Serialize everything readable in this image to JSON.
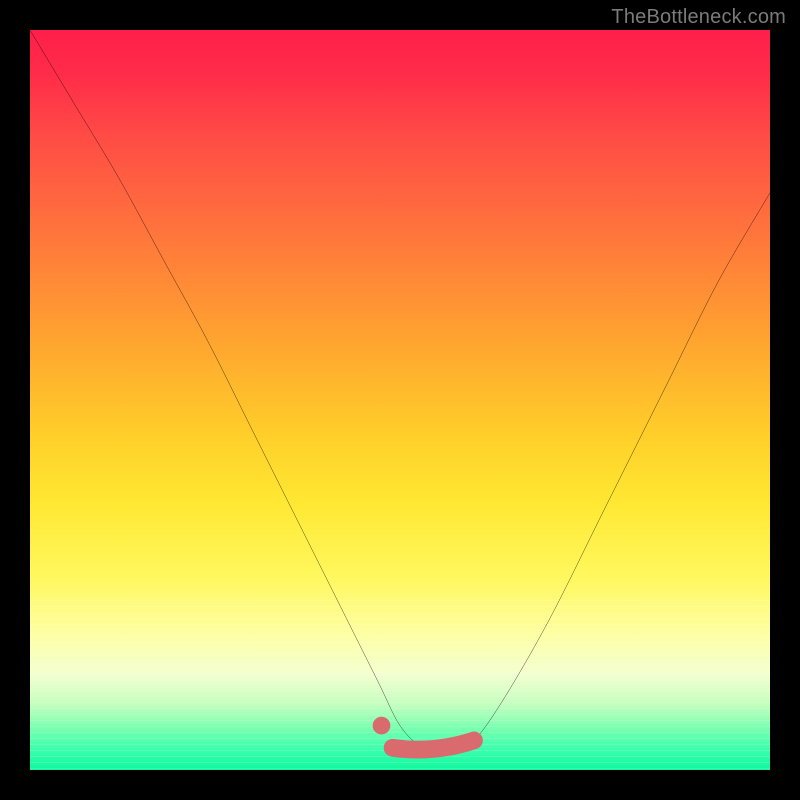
{
  "watermark": {
    "text": "TheBottleneck.com"
  },
  "chart_data": {
    "type": "line",
    "title": "",
    "xlabel": "",
    "ylabel": "",
    "xlim": [
      0,
      100
    ],
    "ylim": [
      0,
      100
    ],
    "grid": false,
    "legend": false,
    "background_gradient": {
      "orientation": "vertical",
      "stops": [
        {
          "pos": 0.0,
          "color": "#ff1f4a"
        },
        {
          "pos": 0.5,
          "color": "#ffcf29"
        },
        {
          "pos": 0.8,
          "color": "#fdffa6"
        },
        {
          "pos": 1.0,
          "color": "#10f7a0"
        }
      ]
    },
    "series": [
      {
        "name": "bottleneck-curve",
        "color": "#000000",
        "x": [
          0,
          6,
          12,
          18,
          24,
          30,
          36,
          42,
          47,
          50,
          53,
          56,
          59,
          63,
          70,
          78,
          86,
          93,
          100
        ],
        "y": [
          100,
          90,
          80,
          69,
          58,
          46,
          34,
          22,
          12,
          6,
          3,
          2,
          3,
          8,
          20,
          36,
          52,
          66,
          78
        ]
      }
    ],
    "markers": [
      {
        "name": "flat-valley-segment",
        "type": "segment",
        "color": "#d96b6f",
        "x0": 49,
        "x1": 60,
        "y": 3
      },
      {
        "name": "valley-start-dot",
        "type": "dot",
        "color": "#d96b6f",
        "x": 47.5,
        "y": 6,
        "r": 1.2
      }
    ]
  }
}
